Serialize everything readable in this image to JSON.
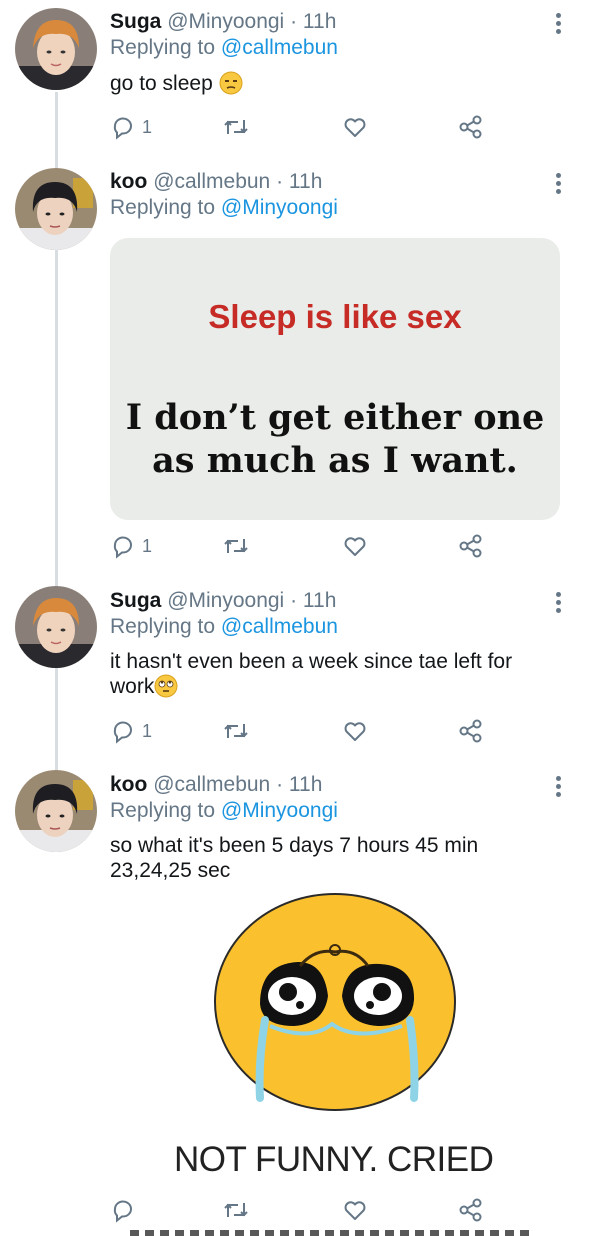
{
  "tweets": [
    {
      "name": "Suga",
      "handle": "@Minyoongi",
      "time": "11h",
      "replying_prefix": "Replying to ",
      "replying_to": "@callmebun",
      "text": "go to sleep",
      "emoji": "unamused-face",
      "reply_count": "1"
    },
    {
      "name": "koo",
      "handle": "@callmebun",
      "time": "11h",
      "replying_prefix": "Replying to ",
      "replying_to": "@Minyoongi",
      "media_line1": "Sleep is like sex",
      "media_line2a": "I don’t get either one",
      "media_line2b": "as much as I want.",
      "reply_count": "1"
    },
    {
      "name": "Suga",
      "handle": "@Minyoongi",
      "time": "11h",
      "replying_prefix": "Replying to ",
      "replying_to": "@callmebun",
      "text_line1": "it hasn't even been a week since tae left for",
      "text_line2": "work",
      "emoji": "face-with-rolling-eyes",
      "reply_count": "1"
    },
    {
      "name": "koo",
      "handle": "@callmebun",
      "time": "11h",
      "replying_prefix": "Replying to ",
      "replying_to": "@Minyoongi",
      "text_line1": "so what it's been 5 days 7 hours 45 min",
      "text_line2": "23,24,25 sec",
      "meme_caption": "NOT FUNNY. CRIED"
    }
  ],
  "separator": " · ",
  "icons": {
    "reply": "reply-icon",
    "retweet": "retweet-icon",
    "like": "heart-icon",
    "share": "share-icon",
    "more": "more-vertical-icon"
  },
  "colors": {
    "link": "#1b95e0",
    "muted": "#657786",
    "text": "#14171a",
    "thread_line": "#d8dde1"
  }
}
